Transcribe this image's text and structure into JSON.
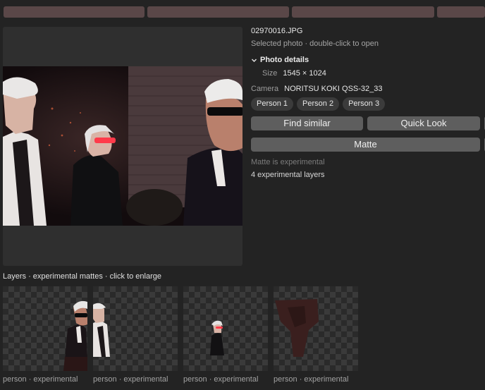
{
  "file": {
    "name": "02970016.JPG",
    "hint": "Selected photo · double-click to open"
  },
  "details": {
    "section_title": "Photo details",
    "size_label": "Size",
    "size_value": "1545 × 1024",
    "camera_label": "Camera",
    "camera_value": "NORITSU KOKI QSS-32_33"
  },
  "people": [
    "Person 1",
    "Person 2",
    "Person 3"
  ],
  "actions": {
    "find_similar": "Find similar",
    "quick_look": "Quick Look",
    "matte": "Matte"
  },
  "matte_note": "Matte is experimental",
  "layers_count": "4 experimental layers",
  "layers": {
    "caption": "Layers · experimental mattes · click to enlarge",
    "items": [
      {
        "label": "person · experimental"
      },
      {
        "label": "person · experimental"
      },
      {
        "label": "person · experimental"
      },
      {
        "label": "person · experimental"
      }
    ]
  },
  "colors": {
    "background": "#232323",
    "strip_bar": "#5a4748",
    "button": "#5e5e5e",
    "chip": "#3b3b3b"
  },
  "icons": {
    "section_toggle": "chevron-down-icon"
  }
}
